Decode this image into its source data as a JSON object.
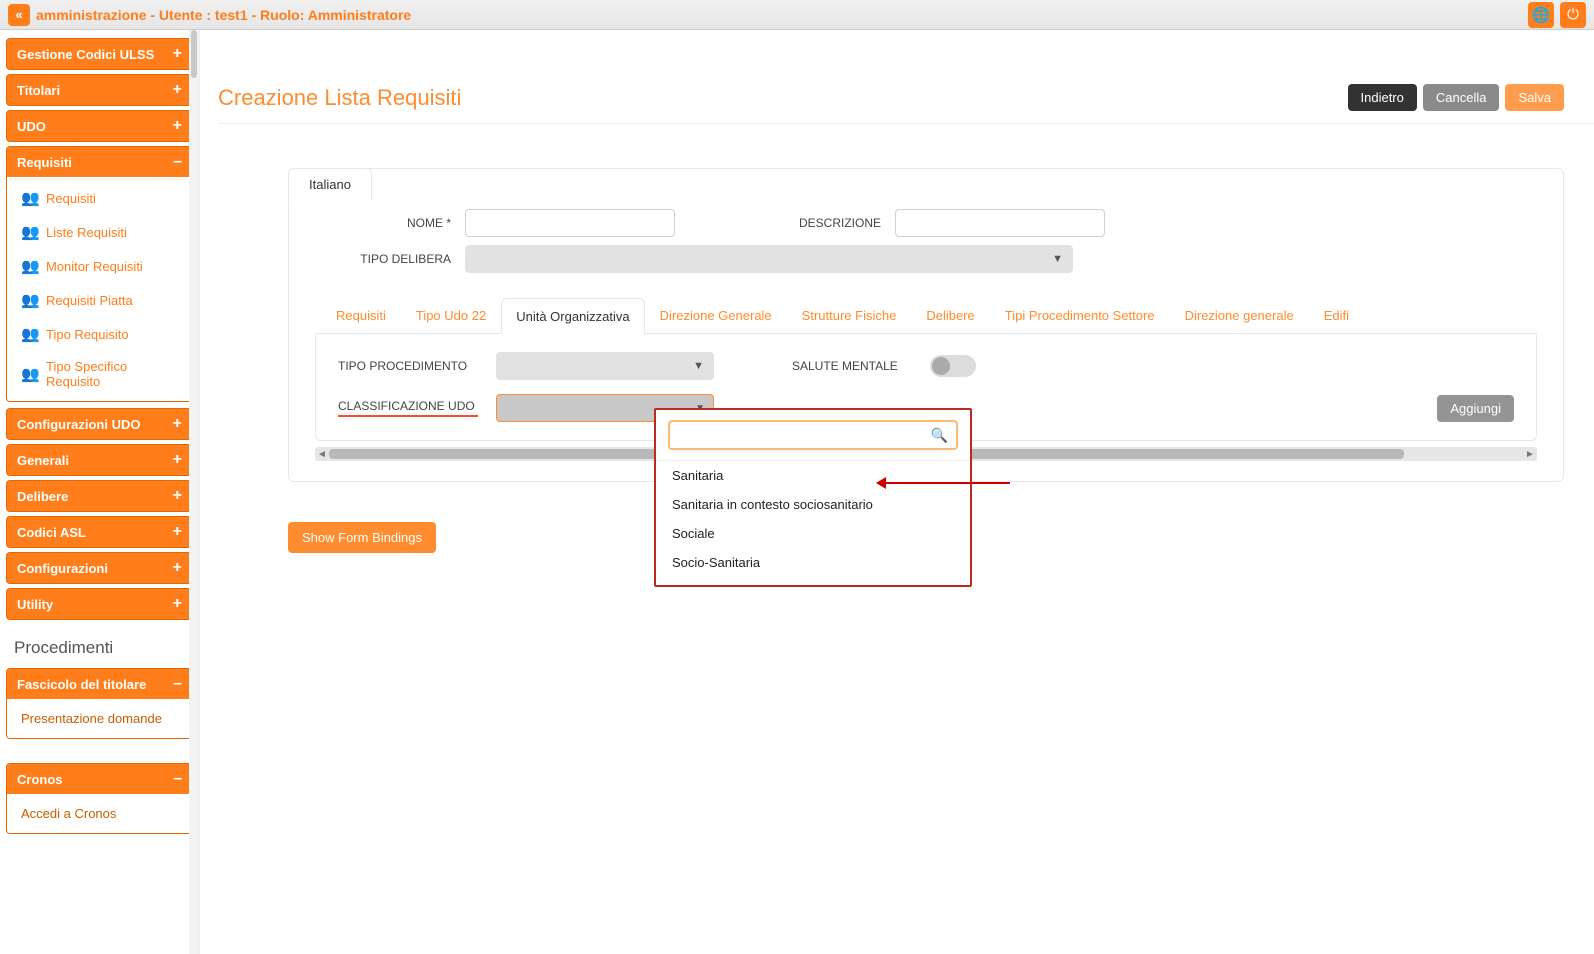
{
  "header": {
    "title": "amministrazione - Utente : test1 - Ruolo: Amministratore"
  },
  "sidebar": {
    "groups": [
      {
        "label": "Gestione Codici ULSS",
        "state": "plus"
      },
      {
        "label": "Titolari",
        "state": "plus"
      },
      {
        "label": "UDO",
        "state": "plus"
      }
    ],
    "requisiti": {
      "label": "Requisiti",
      "items": [
        "Requisiti",
        "Liste Requisiti",
        "Monitor Requisiti",
        "Requisiti Piatta",
        "Tipo Requisito",
        "Tipo Specifico Requisito"
      ]
    },
    "groups2": [
      {
        "label": "Configurazioni UDO",
        "state": "plus"
      },
      {
        "label": "Generali",
        "state": "plus"
      },
      {
        "label": "Delibere",
        "state": "plus"
      },
      {
        "label": "Codici ASL",
        "state": "plus"
      },
      {
        "label": "Configurazioni",
        "state": "plus"
      },
      {
        "label": "Utility",
        "state": "plus"
      }
    ],
    "procedimenti_label": "Procedimenti",
    "fascicolo": {
      "label": "Fascicolo del titolare",
      "item": "Presentazione domande"
    },
    "cronos": {
      "label": "Cronos",
      "item": "Accedi a Cronos"
    }
  },
  "page": {
    "title": "Creazione Lista Requisiti",
    "buttons": {
      "back": "Indietro",
      "cancel": "Cancella",
      "save": "Salva"
    }
  },
  "form": {
    "language_tab": "Italiano",
    "labels": {
      "nome": "NOME *",
      "descrizione": "DESCRIZIONE",
      "tipo_delibera": "TIPO DELIBERA"
    },
    "tabs": [
      "Requisiti",
      "Tipo Udo 22",
      "Unità Organizzativa",
      "Direzione Generale",
      "Strutture Fisiche",
      "Delibere",
      "Tipi Procedimento Settore",
      "Direzione generale",
      "Edifi"
    ],
    "active_tab_index": 2,
    "uo": {
      "tipo_procedimento_label": "TIPO PROCEDIMENTO",
      "salute_mentale_label": "SALUTE MENTALE",
      "classificazione_label": "CLASSIFICAZIONE UDO",
      "aggiungi_label": "Aggiungi"
    },
    "dropdown_options": [
      "Sanitaria",
      "Sanitaria in contesto sociosanitario",
      "Sociale",
      "Socio-Sanitaria"
    ],
    "dropdown_search_value": ""
  },
  "show_bindings_label": "Show Form Bindings"
}
